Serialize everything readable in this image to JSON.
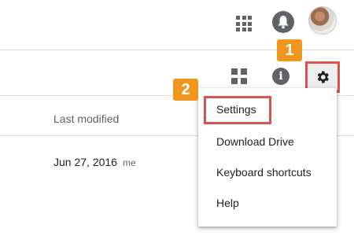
{
  "header": {
    "icons": [
      "apps-grid-icon",
      "notifications-bell-icon",
      "account-avatar"
    ]
  },
  "toolbar": {
    "icons": [
      "grid-view-icon",
      "info-icon",
      "settings-gear-icon"
    ]
  },
  "table": {
    "columns": [
      "Last modified"
    ],
    "rows": [
      {
        "date": "Jun 27, 2016",
        "owner": "me"
      }
    ]
  },
  "menu": {
    "items": [
      {
        "label": "Settings"
      },
      {
        "label": "Download Drive"
      },
      {
        "label": "Keyboard shortcuts"
      },
      {
        "label": "Help"
      }
    ]
  },
  "callouts": {
    "step1": "1",
    "step2": "2"
  },
  "colors": {
    "highlight_border": "#d9534f",
    "callout_bg": "#f0961e",
    "icon_gray": "#5f6368"
  }
}
